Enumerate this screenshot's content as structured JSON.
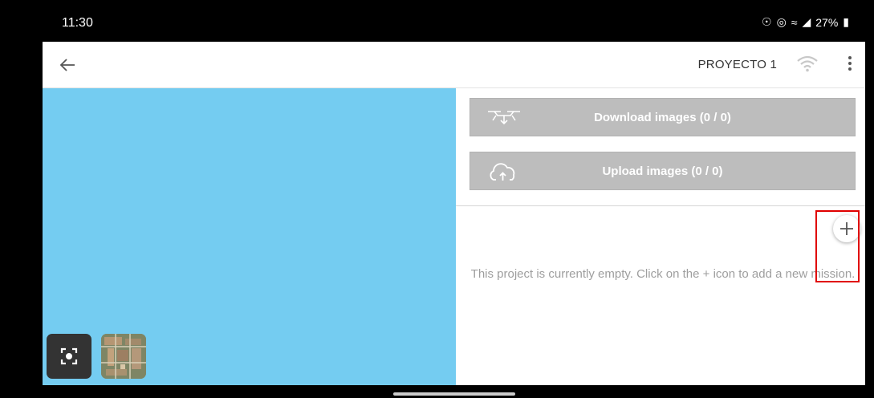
{
  "status": {
    "time": "11:30",
    "battery": "27%"
  },
  "appbar": {
    "title": "PROYECTO 1",
    "icons": [
      "back-arrow-icon",
      "wifi-icon",
      "more-vert-icon"
    ]
  },
  "map": {
    "background": "#74ccf1",
    "icons": [
      "focus-location-icon"
    ]
  },
  "panel": {
    "download_label": "Download images (0 / 0)",
    "upload_label": "Upload images (0 / 0)",
    "empty_message": "This project is currently empty. Click on the + icon to add a new mission.",
    "icons": [
      "drone-download-icon",
      "cloud-upload-icon",
      "plus-icon"
    ]
  },
  "colors": {
    "button_gray": "#bdbdbd",
    "highlight": "#e00000"
  }
}
